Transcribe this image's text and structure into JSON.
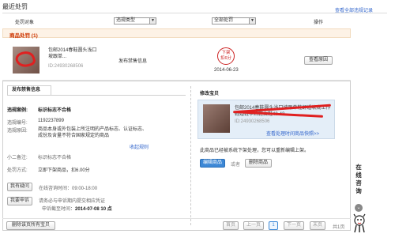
{
  "header": {
    "title": "最近处罚",
    "view_all_link": "查看全部违规记录"
  },
  "filters": {
    "object_label": "处罚对象",
    "type_select": "违规类型",
    "status_select": "全部处罚",
    "op_label": "操作"
  },
  "category": {
    "label": "商品处罚 (1)"
  },
  "row": {
    "title": "包邮2014春鞋圆头浅口坡跟单...",
    "product_id": "ID:24930268506",
    "reason": "发布禁售信息",
    "stamp": "下架\n扣6分",
    "date": "2014-06-23",
    "view_reason_btn": "查看原因"
  },
  "detail": {
    "tab_label": "发布禁售信息",
    "violation_case_label": "违规案例:",
    "violation_case_value": "标识标志不合格",
    "violation_no_label": "违规编号:",
    "violation_no_value": "1192237899",
    "violation_reason_label": "违规原因:",
    "violation_reason_value": "商品本身或外包装上所注明的产品标志、认证标志、成份及含量不符合国家规定的商品",
    "collapse_link": "收起规则",
    "sub_label": "小二备注:",
    "sub_value": "标识标志不合格",
    "penalty_label": "处罚方式:",
    "penalty_value": "立即下架商品，扣6.00分",
    "ask_btn": "我有疑问",
    "ask_info": "在线咨询时间：09:00-18:00",
    "appeal_btn": "我要申诉",
    "appeal_info": "请务必与申诉期内提交相应凭证",
    "deadline_label": "申诉截至时间：",
    "deadline_value": "2014-07-08 10 点"
  },
  "fix": {
    "title": "修改宝贝",
    "product_title": "包邮2014春鞋圆头浅口坡跟单鞋舒适软底工作鞋婚鞋孕妇鞋女鞋40-43",
    "product_id": "ID:24930268506",
    "view_link": "查看处理时间商品快照>>",
    "notice": "此商品已经被系统下架处理，您可以重新编辑上架。",
    "edit_btn": "编辑商品",
    "or_text": "或者",
    "delete_btn": "删除商品"
  },
  "footer": {
    "delete_all_btn": "删除该页所有宝贝",
    "first": "首页",
    "prev": "上一页",
    "current": "1",
    "next": "下一页",
    "last": "末页",
    "total": "共1页"
  },
  "consult": {
    "chars": [
      "在",
      "线",
      "咨",
      "询"
    ]
  }
}
